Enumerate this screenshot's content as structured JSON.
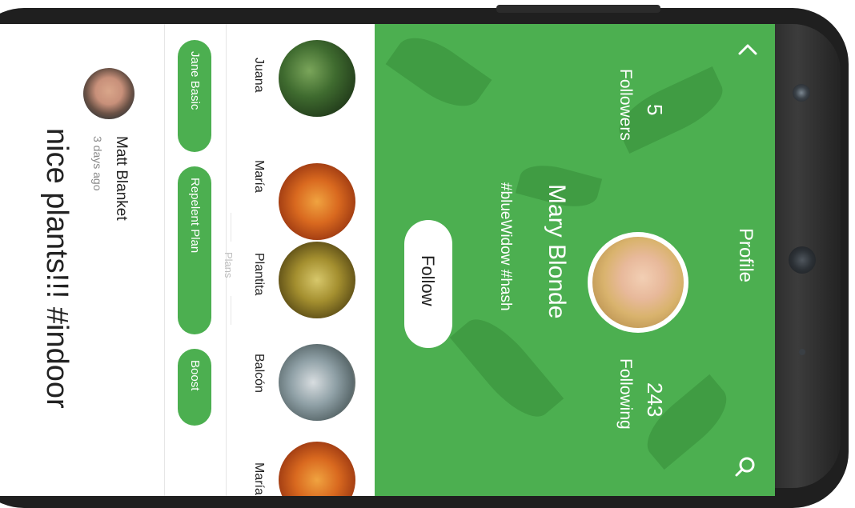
{
  "header": {
    "title": "Profile",
    "back_icon": "chevron-left-icon",
    "search_icon": "search-icon",
    "accent_color": "#4caf50"
  },
  "profile": {
    "name": "Mary Blonde",
    "tags": "#blueWidow #hash",
    "followers_count": "5",
    "followers_label": "Followers",
    "following_count": "243",
    "following_label": "Following",
    "follow_button": "Follow"
  },
  "plants": [
    {
      "name": "Juana"
    },
    {
      "name": "María"
    },
    {
      "name": "Plantita"
    },
    {
      "name": "Balcón"
    },
    {
      "name": "María"
    }
  ],
  "plans": {
    "label": "Plans",
    "items": [
      {
        "label": "Jane Basic"
      },
      {
        "label": "Repelent Plan"
      },
      {
        "label": "Boost"
      }
    ]
  },
  "post": {
    "user": "Matt Blanket",
    "time": "3 days ago",
    "text": "nice plants!!! #indoor"
  }
}
